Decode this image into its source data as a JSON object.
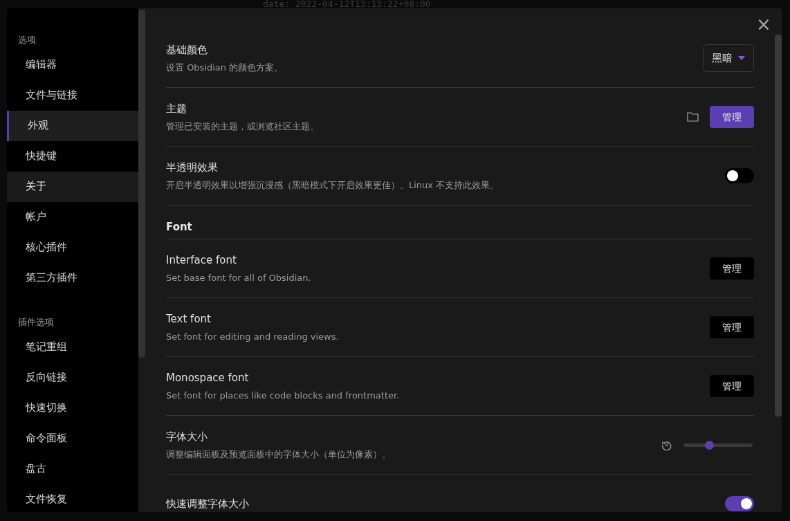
{
  "backdrop": {
    "editor_line": "date: 2022-04-12T13:13:22+08:00"
  },
  "sidebar": {
    "sections": [
      {
        "heading": "选项",
        "items": [
          {
            "label": "编辑器",
            "selected": false,
            "hovered": false
          },
          {
            "label": "文件与链接",
            "selected": false,
            "hovered": false
          },
          {
            "label": "外观",
            "selected": true,
            "hovered": false
          },
          {
            "label": "快捷键",
            "selected": false,
            "hovered": false
          },
          {
            "label": "关于",
            "selected": false,
            "hovered": true
          },
          {
            "label": "帐户",
            "selected": false,
            "hovered": false
          },
          {
            "label": "核心插件",
            "selected": false,
            "hovered": false
          },
          {
            "label": "第三方插件",
            "selected": false,
            "hovered": false
          }
        ]
      },
      {
        "heading": "插件选项",
        "items": [
          {
            "label": "笔记重组",
            "selected": false,
            "hovered": false
          },
          {
            "label": "反向链接",
            "selected": false,
            "hovered": false
          },
          {
            "label": "快速切换",
            "selected": false,
            "hovered": false
          },
          {
            "label": "命令面板",
            "selected": false,
            "hovered": false
          },
          {
            "label": "盘古",
            "selected": false,
            "hovered": false
          },
          {
            "label": "文件恢复",
            "selected": false,
            "hovered": false
          }
        ]
      }
    ]
  },
  "close_button": "×",
  "settings": [
    {
      "kind": "setting",
      "title": "基础颜色",
      "description": "设置 Obsidian 的颜色方案。",
      "control": {
        "kind": "dropdown",
        "value": "黑暗"
      }
    },
    {
      "kind": "setting",
      "title": "主题",
      "description": "管理已安装的主题，或浏览社区主题。",
      "control": {
        "kind": "button",
        "label": "管理",
        "accent": true,
        "folder": true
      }
    },
    {
      "kind": "setting",
      "title": "半透明效果",
      "description": "开启半透明效果以增强沉浸感（黑暗模式下开启效果更佳）。Linux 不支持此效果。",
      "control": {
        "kind": "toggle",
        "on": false
      }
    },
    {
      "kind": "heading",
      "title": "Font"
    },
    {
      "kind": "setting",
      "title": "Interface font",
      "description": "Set base font for all of Obsidian.",
      "control": {
        "kind": "button",
        "label": "管理",
        "accent": false,
        "folder": false
      }
    },
    {
      "kind": "setting",
      "title": "Text font",
      "description": "Set font for editing and reading views.",
      "control": {
        "kind": "button",
        "label": "管理",
        "accent": false,
        "folder": false
      }
    },
    {
      "kind": "setting",
      "title": "Monospace font",
      "description": "Set font for places like code blocks and frontmatter.",
      "control": {
        "kind": "button",
        "label": "管理",
        "accent": false,
        "folder": false
      }
    },
    {
      "kind": "setting",
      "title": "字体大小",
      "description": "调整编辑面板及预览面板中的字体大小（单位为像素）。",
      "control": {
        "kind": "slider",
        "level": 0.37
      }
    },
    {
      "kind": "setting",
      "title": "快速调整字体大小",
      "control": {
        "kind": "toggle",
        "on": true
      }
    }
  ]
}
